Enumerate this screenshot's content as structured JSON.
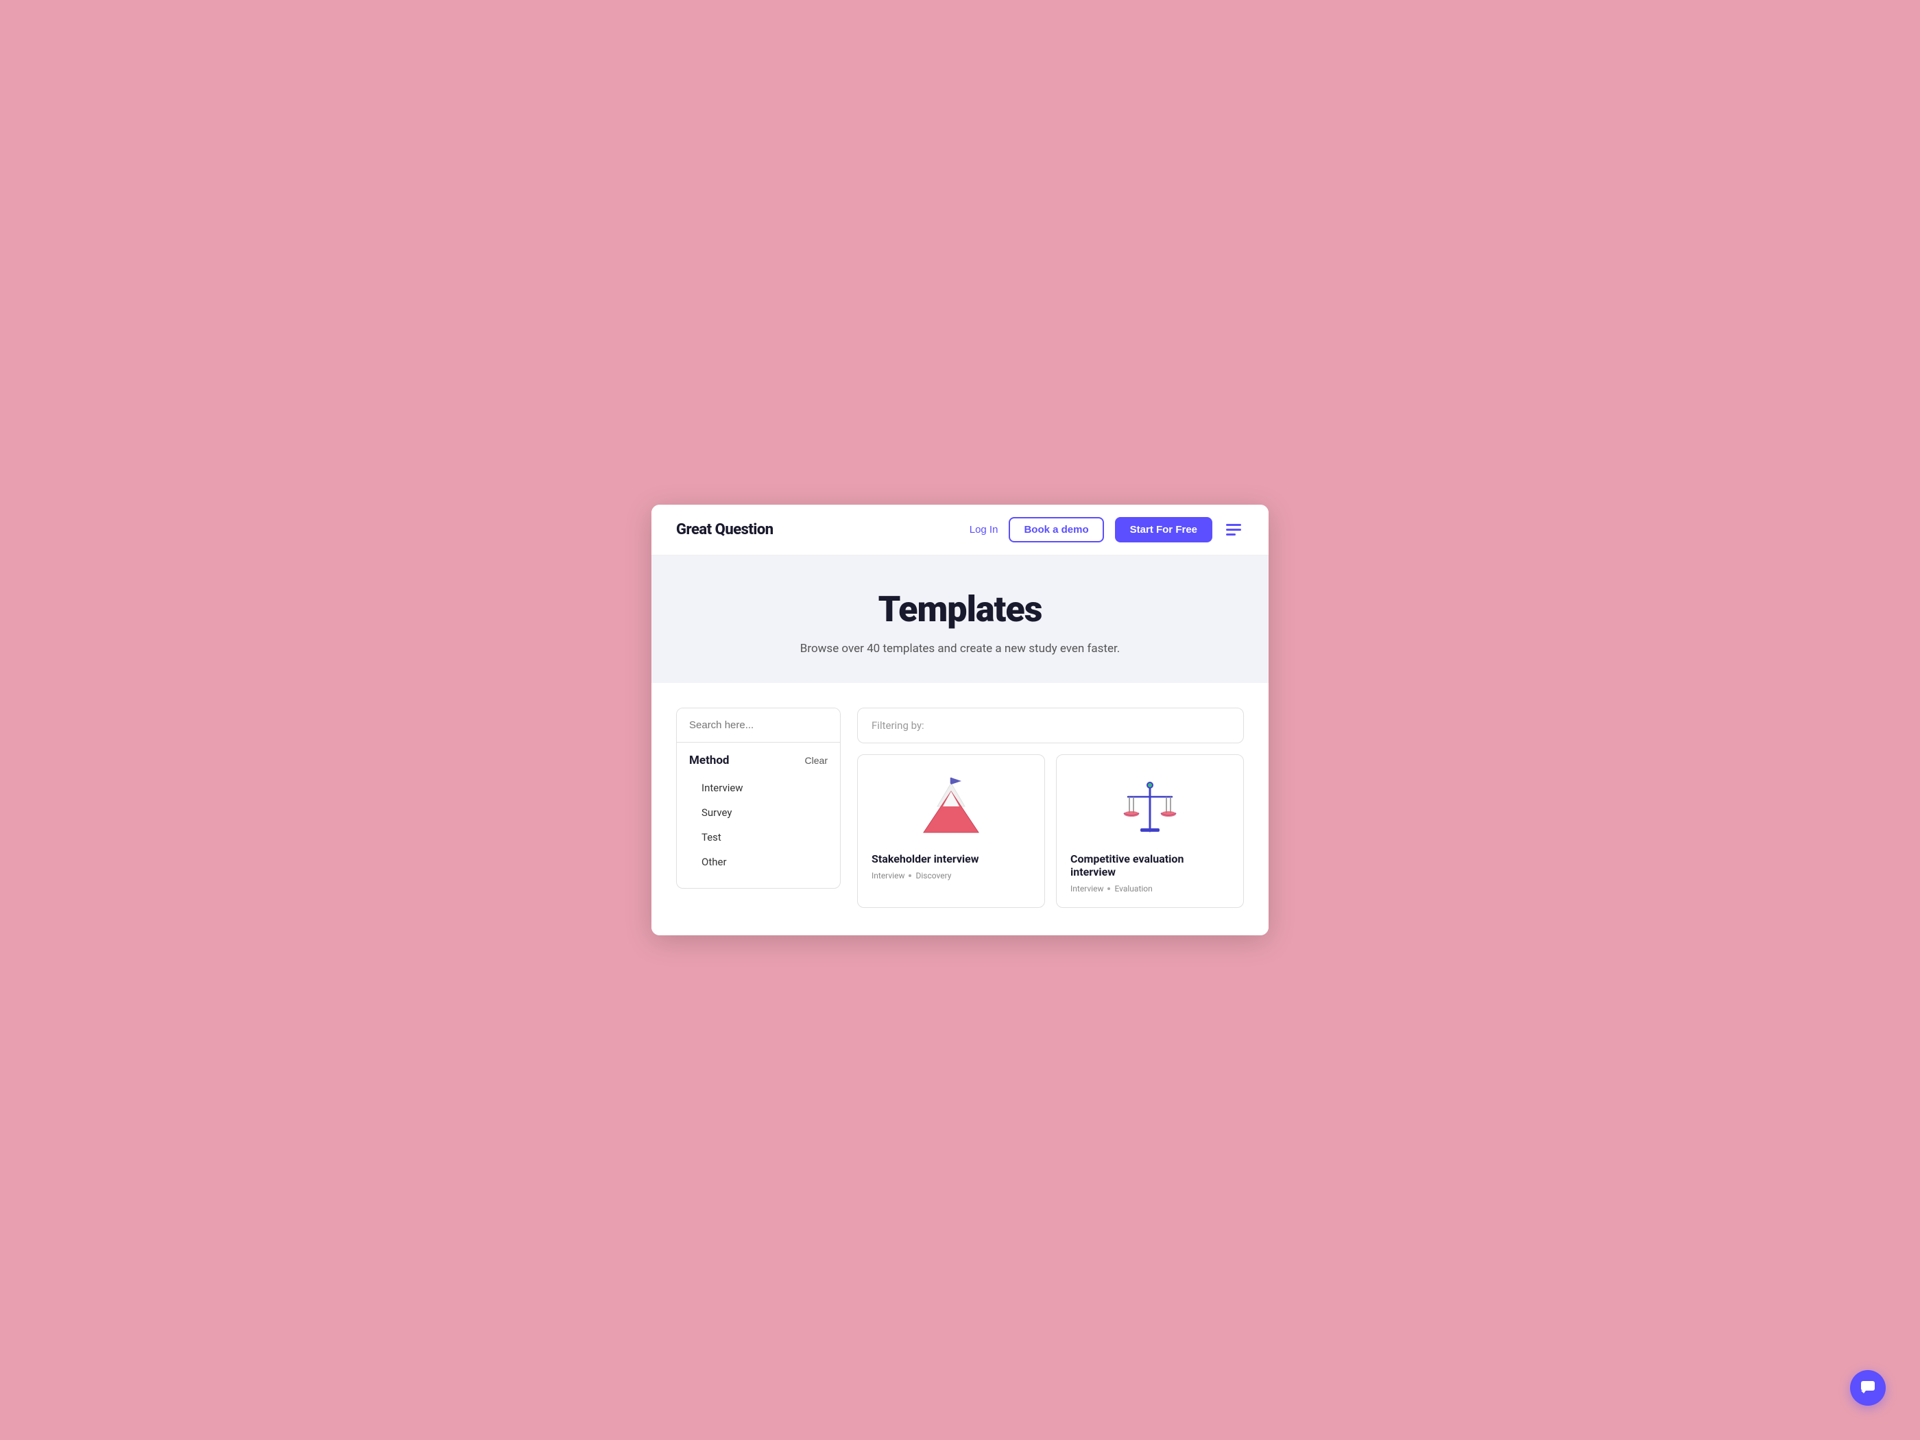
{
  "nav": {
    "logo": "Great Question",
    "login_label": "Log In",
    "book_demo_label": "Book a demo",
    "start_free_label": "Start For Free"
  },
  "hero": {
    "title": "Templates",
    "subtitle": "Browse over 40 templates and create a new study even faster."
  },
  "sidebar": {
    "search_placeholder": "Search here...",
    "method_label": "Method",
    "clear_label": "Clear",
    "items": [
      {
        "label": "Interview"
      },
      {
        "label": "Survey"
      },
      {
        "label": "Test"
      },
      {
        "label": "Other"
      }
    ]
  },
  "filter_bar": {
    "label": "Filtering by:"
  },
  "cards": [
    {
      "title": "Stakeholder interview",
      "tags": [
        "Interview",
        "Discovery"
      ]
    },
    {
      "title": "Competitive evaluation interview",
      "tags": [
        "Interview",
        "Evaluation"
      ]
    }
  ],
  "chat_icon": "chat-icon"
}
